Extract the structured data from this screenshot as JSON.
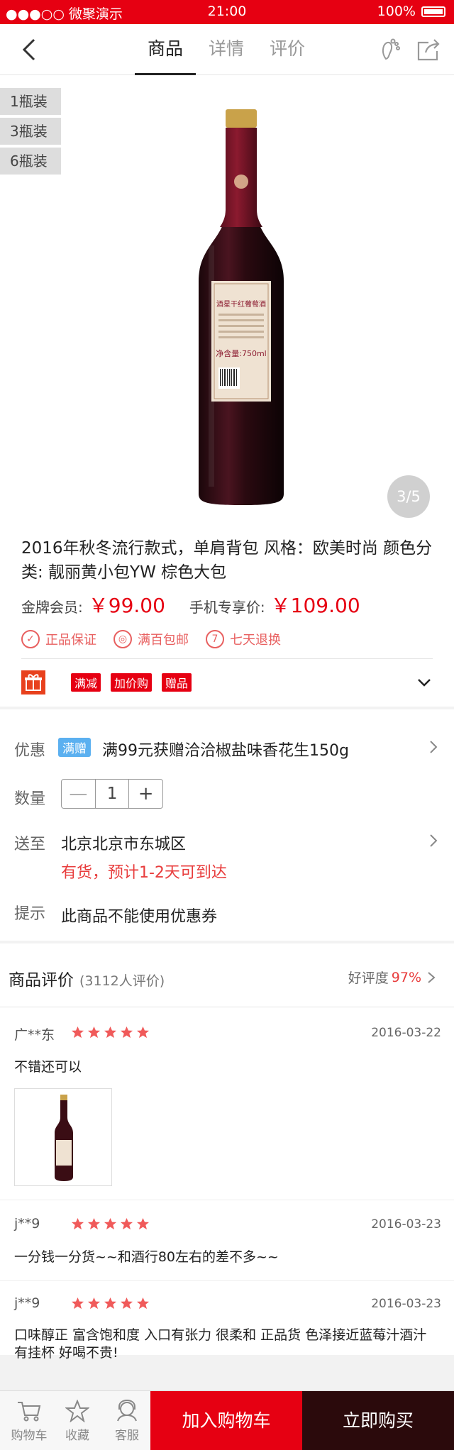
{
  "status_bar": {
    "carrier": "●●●○○ 微聚演示",
    "time": "21:00",
    "battery": "100%"
  },
  "nav": {
    "tabs": [
      "商品",
      "详情",
      "评价"
    ],
    "active_tab": "商品"
  },
  "gallery": {
    "packs": [
      "1瓶装",
      "3瓶装",
      "6瓶装"
    ],
    "page_indicator": "3/5",
    "bottle_label": {
      "name": "酒星干红葡萄酒",
      "volume": "净含量:750ml"
    }
  },
  "product": {
    "title": "2016年秋冬流行款式，单肩背包 风格：欧美时尚 颜色分类: 靓丽黄小包YW 棕色大包",
    "member_price_label": "金牌会员:",
    "member_price": "￥99.00",
    "mobile_price_label": "手机专享价:",
    "mobile_price": "￥109.00",
    "guarantees": [
      "正品保证",
      "满百包邮",
      "七天退换"
    ],
    "promo_tags": [
      "满减",
      "加价购",
      "赠品"
    ]
  },
  "options": {
    "coupon_label": "优惠",
    "coupon_badge": "满赠",
    "coupon_text": "满99元获赠洽洽椒盐味香花生150g",
    "qty_label": "数量",
    "qty_minus": "—",
    "qty_value": "1",
    "qty_plus": "+",
    "ship_label": "送至",
    "ship_address": "北京北京市东城区",
    "stock_text": "有货，预计1-2天可到达",
    "tip_label": "提示",
    "tip_text": "此商品不能使用优惠券"
  },
  "reviews": {
    "title": "商品评价",
    "count": "(3112人评价)",
    "rate_label": "好评度",
    "rate_value": "97%",
    "items": [
      {
        "user": "广**东",
        "rating": 5,
        "date": "2016-03-22",
        "text": "不错还可以"
      },
      {
        "user": "j**9",
        "rating": 5,
        "date": "2016-03-23",
        "text": "一分钱一分货~~和酒行80左右的差不多~~"
      },
      {
        "user": "j**9",
        "rating": 5,
        "date": "2016-03-23",
        "text": "口味醇正 富含饱和度 入口有张力 很柔和 正品货 色泽接近蓝莓汁酒汁有挂杯 好喝不贵!"
      }
    ]
  },
  "bottom_bar": {
    "cart": "购物车",
    "favorite": "收藏",
    "service": "客服",
    "add_to_cart": "加入购物车",
    "buy_now": "立即购买"
  },
  "colors": {
    "brand_red": "#e60012",
    "buy_dark": "#2b0a0c",
    "badge_blue": "#5bb0f0"
  }
}
